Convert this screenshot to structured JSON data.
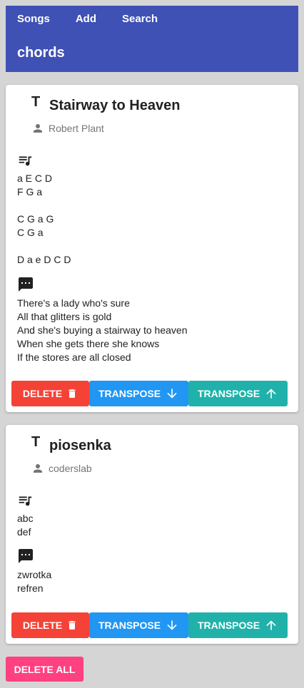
{
  "nav": {
    "songs": "Songs",
    "add": "Add",
    "search": "Search"
  },
  "brand": "chords",
  "icons": {
    "title": "title-icon",
    "author": "person-icon",
    "chords": "queue-music-icon",
    "lyrics": "comment-icon",
    "delete": "trash-icon",
    "down": "arrow-down-icon",
    "up": "arrow-up-icon"
  },
  "colors": {
    "appbar": "#3f51b5",
    "delete": "#f44336",
    "transpose_down": "#2196f3",
    "transpose_up": "#20b2aa",
    "delete_all": "#ff4081"
  },
  "songs": [
    {
      "title": "Stairway to Heaven",
      "author": "Robert Plant",
      "chords": "a E C D\nF G a\n\nC G a G\nC G a\n\nD a e D C D",
      "lyrics": "There's a lady who's sure\nAll that glitters is gold\nAnd she's buying a stairway to heaven\nWhen she gets there she knows\nIf the stores are all closed"
    },
    {
      "title": "piosenka",
      "author": "coderslab",
      "chords": "abc\ndef",
      "lyrics": "zwrotka\nrefren"
    }
  ],
  "buttons": {
    "delete": "DELETE",
    "transpose": "TRANSPOSE",
    "delete_all": "DELETE ALL"
  }
}
